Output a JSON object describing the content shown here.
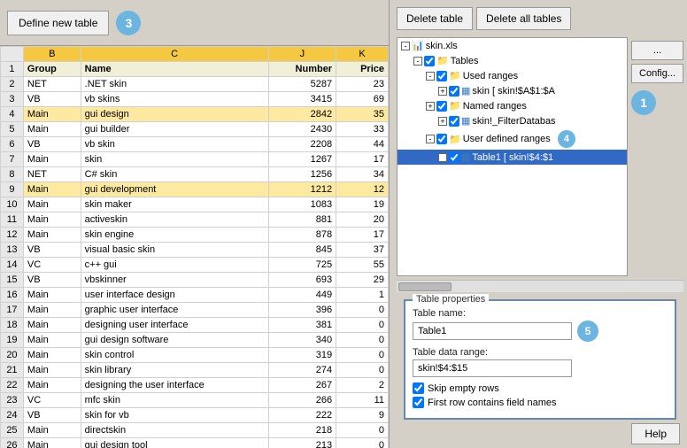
{
  "toolbar": {
    "define_table_label": "Define new table",
    "badge_toolbar": "3"
  },
  "buttons": {
    "delete_table": "Delete table",
    "delete_all_tables": "Delete all tables",
    "ellipsis": "...",
    "config": "Config...",
    "help": "Help"
  },
  "spreadsheet": {
    "col_headers": [
      "",
      "B",
      "C",
      "J",
      "K"
    ],
    "col_labels": [
      "Group",
      "Name",
      "Number",
      "Price"
    ],
    "rows": [
      {
        "num": "1",
        "b": "Group",
        "c": "Name",
        "j": "Number",
        "k": "Price",
        "is_header": true
      },
      {
        "num": "2",
        "b": "NET",
        "c": ".NET skin",
        "j": "5287",
        "k": "23"
      },
      {
        "num": "3",
        "b": "VB",
        "c": "vb skins",
        "j": "3415",
        "k": "69"
      },
      {
        "num": "4",
        "b": "Main",
        "c": "gui design",
        "j": "2842",
        "k": "35"
      },
      {
        "num": "5",
        "b": "Main",
        "c": "gui builder",
        "j": "2430",
        "k": "33"
      },
      {
        "num": "6",
        "b": "VB",
        "c": "vb skin",
        "j": "2208",
        "k": "44"
      },
      {
        "num": "7",
        "b": "Main",
        "c": "skin",
        "j": "1267",
        "k": "17"
      },
      {
        "num": "8",
        "b": "NET",
        "c": "C# skin",
        "j": "1256",
        "k": "34"
      },
      {
        "num": "9",
        "b": "Main",
        "c": "gui development",
        "j": "1212",
        "k": "12"
      },
      {
        "num": "10",
        "b": "Main",
        "c": "skin maker",
        "j": "1083",
        "k": "19"
      },
      {
        "num": "11",
        "b": "Main",
        "c": "activeskin",
        "j": "881",
        "k": "20"
      },
      {
        "num": "12",
        "b": "Main",
        "c": "skin engine",
        "j": "878",
        "k": "17"
      },
      {
        "num": "13",
        "b": "VB",
        "c": "visual basic skin",
        "j": "845",
        "k": "37"
      },
      {
        "num": "14",
        "b": "VC",
        "c": "c++ gui",
        "j": "725",
        "k": "55"
      },
      {
        "num": "15",
        "b": "VB",
        "c": "vbskinner",
        "j": "693",
        "k": "29"
      },
      {
        "num": "16",
        "b": "Main",
        "c": "user interface design",
        "j": "449",
        "k": "1"
      },
      {
        "num": "17",
        "b": "Main",
        "c": "graphic user interface",
        "j": "396",
        "k": "0"
      },
      {
        "num": "18",
        "b": "Main",
        "c": "designing user interface",
        "j": "381",
        "k": "0"
      },
      {
        "num": "19",
        "b": "Main",
        "c": "gui design software",
        "j": "340",
        "k": "0"
      },
      {
        "num": "20",
        "b": "Main",
        "c": "skin control",
        "j": "319",
        "k": "0"
      },
      {
        "num": "21",
        "b": "Main",
        "c": "skin library",
        "j": "274",
        "k": "0"
      },
      {
        "num": "22",
        "b": "Main",
        "c": "designing the user interface",
        "j": "267",
        "k": "2"
      },
      {
        "num": "23",
        "b": "VC",
        "c": "mfc skin",
        "j": "266",
        "k": "11"
      },
      {
        "num": "24",
        "b": "VB",
        "c": "skin for vb",
        "j": "222",
        "k": "9"
      },
      {
        "num": "25",
        "b": "Main",
        "c": "directskin",
        "j": "218",
        "k": "0"
      },
      {
        "num": "26",
        "b": "Main",
        "c": "gui design tool",
        "j": "213",
        "k": "0"
      }
    ]
  },
  "tree": {
    "badge": "4",
    "root": "skin.xls",
    "items": [
      {
        "id": "root",
        "label": "skin.xls",
        "level": 1,
        "type": "file",
        "expand": "-"
      },
      {
        "id": "tables",
        "label": "Tables",
        "level": 2,
        "type": "folder",
        "expand": "-"
      },
      {
        "id": "used",
        "label": "Used ranges",
        "level": 3,
        "type": "folder",
        "expand": "-"
      },
      {
        "id": "skin_used",
        "label": "skin [ skin!$A$1:$A",
        "level": 4,
        "type": "table",
        "expand": "+"
      },
      {
        "id": "named",
        "label": "Named ranges",
        "level": 3,
        "type": "folder",
        "expand": "+"
      },
      {
        "id": "skin_filter",
        "label": "skin!_FilterDatabas",
        "level": 4,
        "type": "table",
        "expand": "+"
      },
      {
        "id": "user_def",
        "label": "User defined ranges",
        "level": 3,
        "type": "folder",
        "expand": "-"
      },
      {
        "id": "table1",
        "label": "Table1 [ skin!$4:$1",
        "level": 4,
        "type": "table",
        "expand": "+",
        "selected": true
      }
    ]
  },
  "properties": {
    "title": "Table properties",
    "name_label": "Table name:",
    "name_value": "Table1",
    "range_label": "Table data range:",
    "range_value": "skin!$4:$15",
    "badge": "5",
    "skip_empty_label": "Skip empty rows",
    "first_row_label": "First row contains field names",
    "skip_empty_checked": true,
    "first_row_checked": true
  }
}
